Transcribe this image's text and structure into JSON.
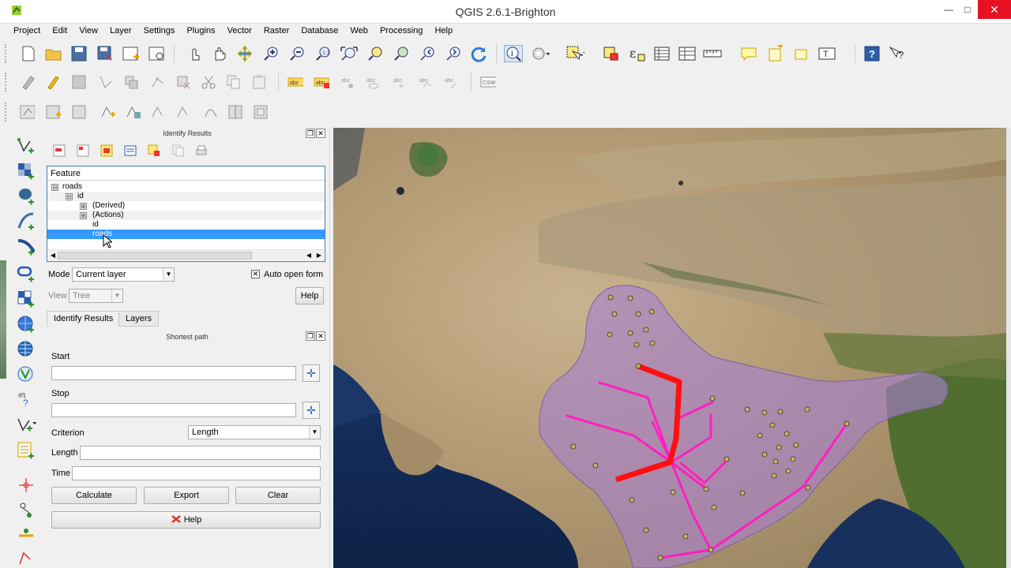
{
  "window": {
    "title": "QGIS 2.6.1-Brighton",
    "minimize": "—",
    "maximize": "□",
    "close": "✕"
  },
  "menu": [
    "Project",
    "Edit",
    "View",
    "Layer",
    "Settings",
    "Plugins",
    "Vector",
    "Raster",
    "Database",
    "Web",
    "Processing",
    "Help"
  ],
  "identify_panel": {
    "title": "Identify Results",
    "tree_header": "Feature",
    "tree_rows": [
      {
        "label": "roads",
        "expander": "⊟",
        "level": 0
      },
      {
        "label": "id",
        "expander": "⊟",
        "level": 1
      },
      {
        "label": "(Derived)",
        "expander": "⊞",
        "level": 2
      },
      {
        "label": "(Actions)",
        "expander": "⊞",
        "level": 2
      },
      {
        "label": "id",
        "expander": "",
        "level": 2
      },
      {
        "label": "roads",
        "expander": "",
        "level": 2,
        "selected": true
      }
    ],
    "mode_label": "Mode",
    "mode_value": "Current layer",
    "auto_open_label": "Auto open form",
    "auto_open_checked": true,
    "view_label": "View",
    "view_value": "Tree",
    "help_label": "Help",
    "tabs": [
      "Identify Results",
      "Layers"
    ]
  },
  "shortest_path": {
    "title": "Shortest path",
    "start_label": "Start",
    "start_value": "",
    "stop_label": "Stop",
    "stop_value": "",
    "criterion_label": "Criterion",
    "criterion_value": "Length",
    "length_label": "Length",
    "length_value": "",
    "time_label": "Time",
    "time_value": "",
    "calculate_label": "Calculate",
    "export_label": "Export",
    "clear_label": "Clear",
    "help_label": "Help"
  },
  "colors": {
    "selection": "#3399ff",
    "road_line": "#ff1fc0",
    "shortest_path": "#ff1010",
    "region_fill": "#a77fd1",
    "close_button": "#e81123"
  },
  "icons": {
    "toolbar1": [
      "new-project-icon",
      "open-project-icon",
      "save-project-icon",
      "save-as-icon",
      "new-print-composer-icon",
      "composer-manager-icon",
      "touch-zoom-icon",
      "pan-icon",
      "pan-to-selection-icon",
      "zoom-in-icon",
      "zoom-out-icon",
      "zoom-actual-icon",
      "zoom-full-icon",
      "zoom-to-selection-icon",
      "zoom-to-layer-icon",
      "zoom-last-icon",
      "zoom-next-icon",
      "refresh-icon",
      "identify-icon",
      "run-action-icon",
      "select-icon",
      "deselect-icon",
      "expression-select-icon",
      "attribute-table-icon",
      "statistics-icon",
      "measure-icon",
      "map-tips-icon",
      "new-bookmark-icon",
      "show-bookmarks-icon",
      "text-annotation-icon",
      "help-contents-icon",
      "whats-this-icon"
    ],
    "left": [
      "add-vector-layer-icon",
      "add-raster-layer-icon",
      "add-postgis-icon",
      "add-spatialite-icon",
      "add-mssql-icon",
      "add-oracle-icon",
      "add-wms-icon",
      "add-wcs-icon",
      "add-wfs-icon",
      "add-delimited-text-icon",
      "new-shapefile-icon",
      "add-virtual-layer-icon",
      "capture-point-icon",
      "georeferencer-icon",
      "digitize-icon",
      "node-tool-icon"
    ]
  }
}
